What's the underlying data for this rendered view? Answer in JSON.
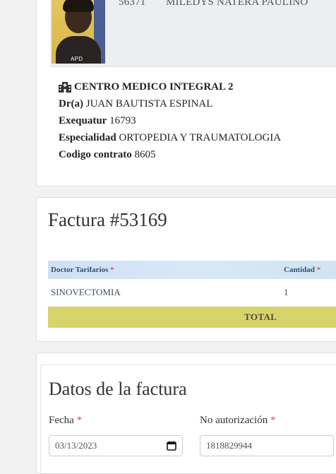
{
  "patient": {
    "photo_tag": "APD",
    "id": "56371",
    "name": "MILEDYS NATERA PAULINO"
  },
  "clinic": {
    "name": "CENTRO MEDICO INTEGRAL 2",
    "doctor_label": "Dr(a)",
    "doctor": "JUAN BAUTISTA ESPINAL",
    "exequatur_label": "Exequatur",
    "exequatur": "16793",
    "specialty_label": "Especialidad",
    "specialty": "ORTOPEDIA Y TRAUMATOLOGIA",
    "contract_label": "Codigo contrato",
    "contract": "8605"
  },
  "invoice": {
    "title": "Factura #53169",
    "columns": {
      "doctor": "Doctor Tarifarios",
      "quantity": "Cantidad",
      "required_mark": "*"
    },
    "rows": [
      {
        "item": "SINOVECTOMIA",
        "quantity": "1"
      }
    ],
    "total_label": "TOTAL"
  },
  "details": {
    "title": "Datos de la factura",
    "date_label": "Fecha",
    "date_value": "03/13/2023",
    "auth_label": "No autorización",
    "auth_value": "1818829944",
    "required_mark": "*"
  },
  "colors": {
    "table_header": "#d3e4f6",
    "total_row": "#d7d46a",
    "required": "#d9534f"
  },
  "icons": [
    "hospital-icon",
    "calendar-icon"
  ]
}
